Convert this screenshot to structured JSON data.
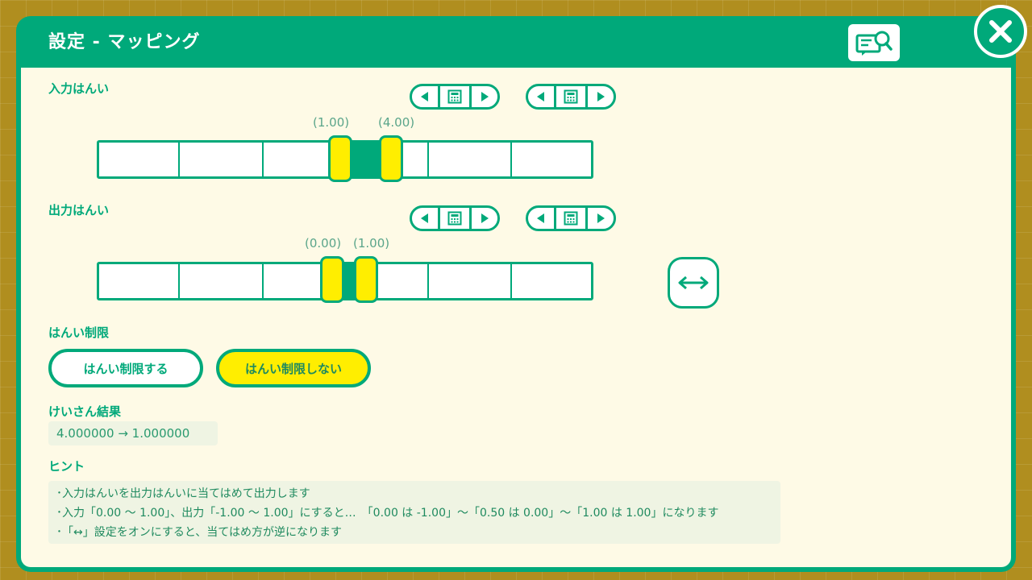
{
  "header": {
    "title": "設定 - マッピング"
  },
  "input_range": {
    "label": "入力はんい",
    "min_value": "(1.00)",
    "max_value": "(4.00)"
  },
  "output_range": {
    "label": "出力はんい",
    "min_value": "(0.00)",
    "max_value": "(1.00)"
  },
  "swap": {
    "icon": "swap-arrows-icon"
  },
  "limit": {
    "label": "はんい制限",
    "options": [
      {
        "label": "はんい制限する",
        "selected": false
      },
      {
        "label": "はんい制限しない",
        "selected": true
      }
    ]
  },
  "result": {
    "label": "けいさん結果",
    "value": "4.000000 → 1.000000"
  },
  "hint": {
    "label": "ヒント",
    "lines": [
      "･入力はんいを出力はんいに当てはめて出力します",
      "･入力「0.00 ～ 1.00」、出力「-1.00 ～ 1.00」にすると…　「0.00 は -1.00」～「0.50 は 0.00」～「1.00 は 1.00」になります",
      "･「↔」設定をオンにすると、当てはめ方が逆になります"
    ]
  },
  "colors": {
    "accent": "#00a97a",
    "highlight": "#ffee00",
    "panel": "#fefae6",
    "background": "#b08e1f"
  }
}
